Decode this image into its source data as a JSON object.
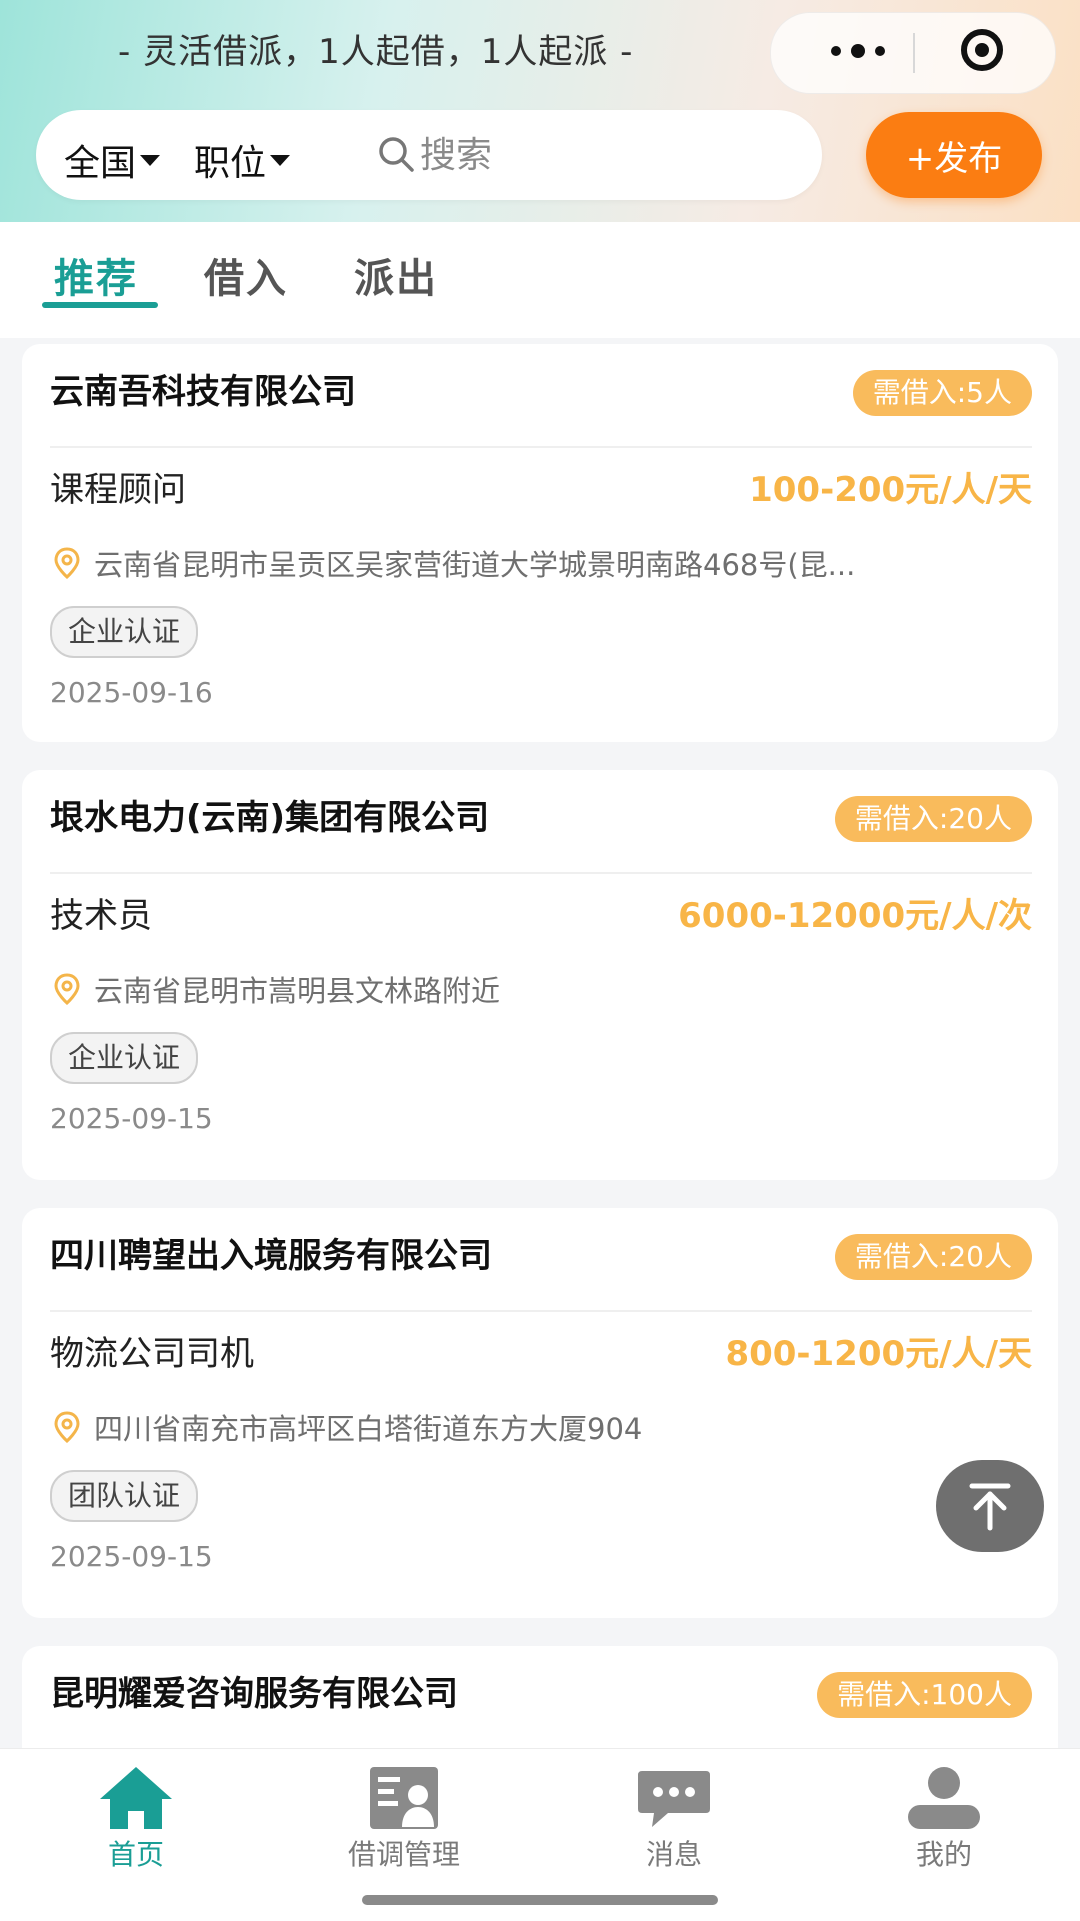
{
  "header": {
    "slogan": "- 灵活借派，1人起借，1人起派 -",
    "region_filter": "全国",
    "position_filter": "职位",
    "search_placeholder": "搜索",
    "publish_label": "+发布"
  },
  "tabs": [
    {
      "label": "推荐",
      "active": true
    },
    {
      "label": "借入",
      "active": false
    },
    {
      "label": "派出",
      "active": false
    }
  ],
  "cards": [
    {
      "company": "云南吾科技有限公司",
      "badge": "需借入:5人",
      "title": "课程顾问",
      "salary": "100-200元/人/天",
      "address": "云南省昆明市呈贡区吴家营街道大学城景明南路468号(昆...",
      "cert": "企业认证",
      "date": "2025-09-16"
    },
    {
      "company": "垠水电力(云南)集团有限公司",
      "badge": "需借入:20人",
      "title": "技术员",
      "salary": "6000-12000元/人/次",
      "address": "云南省昆明市嵩明县文林路附近",
      "cert": "企业认证",
      "date": "2025-09-15"
    },
    {
      "company": "四川聘望出入境服务有限公司",
      "badge": "需借入:20人",
      "title": "物流公司司机",
      "salary": "800-1200元/人/天",
      "address": "四川省南充市高坪区白塔街道东方大厦904",
      "cert": "团队认证",
      "date": "2025-09-15"
    },
    {
      "company": "昆明耀爱咨询服务有限公司",
      "badge": "需借入:100人"
    }
  ],
  "bottom_nav": [
    {
      "label": "首页",
      "icon": "home-icon",
      "active": true
    },
    {
      "label": "借调管理",
      "icon": "management-icon",
      "active": false
    },
    {
      "label": "消息",
      "icon": "message-icon",
      "active": false
    },
    {
      "label": "我的",
      "icon": "profile-icon",
      "active": false
    }
  ],
  "icons": {
    "more": "more-dots-icon",
    "close": "target-icon",
    "search": "search-icon",
    "location": "location-pin-icon",
    "back_to_top": "arrow-up-icon"
  },
  "colors": {
    "accent": "#1a9e95",
    "publish": "#fb7d12",
    "salary": "#f8b547",
    "badge": "#f9bb5c"
  }
}
